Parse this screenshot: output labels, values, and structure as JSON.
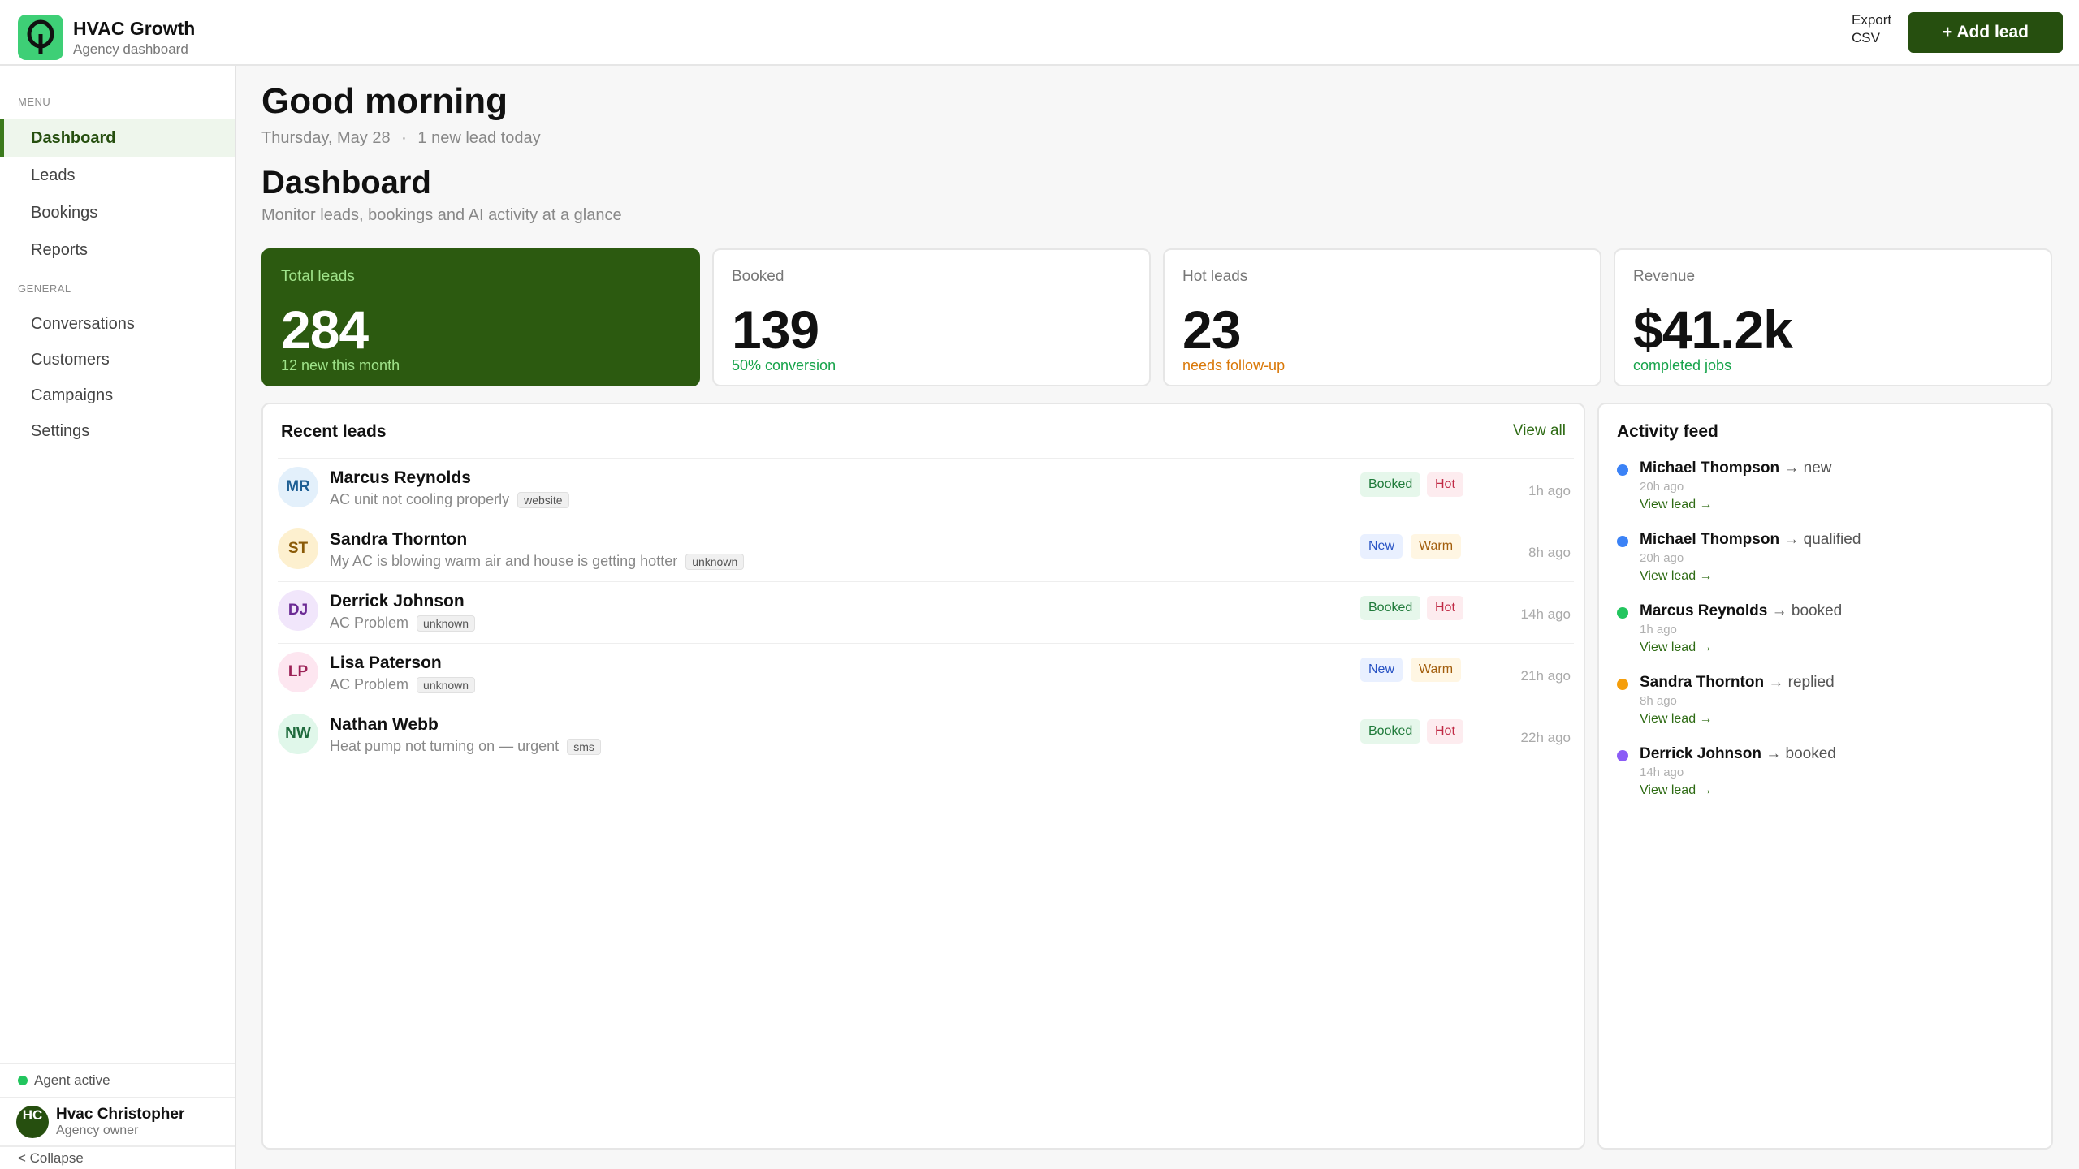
{
  "brand": {
    "name": "HVAC Growth",
    "subtitle": "Agency dashboard"
  },
  "header": {
    "export_label": "Export CSV",
    "add_lead_label": "+ Add lead"
  },
  "sidebar": {
    "menu_heading": "MENU",
    "menu_items": [
      {
        "label": "Dashboard",
        "active": true
      },
      {
        "label": "Leads"
      },
      {
        "label": "Bookings"
      },
      {
        "label": "Reports"
      }
    ],
    "general_heading": "GENERAL",
    "general_items": [
      {
        "label": "Conversations"
      },
      {
        "label": "Customers"
      },
      {
        "label": "Campaigns"
      },
      {
        "label": "Settings"
      }
    ],
    "agent_status": "Agent active",
    "user": {
      "initials": "HC",
      "name": "Hvac Christopher",
      "role": "Agency owner"
    },
    "collapse_label": "< Collapse"
  },
  "greeting": {
    "title": "Good morning",
    "date": "Thursday, May 28",
    "separator": "·",
    "note": "1 new lead today"
  },
  "page": {
    "title": "Dashboard",
    "subtitle": "Monitor leads, bookings and AI activity at a glance"
  },
  "stats": [
    {
      "label": "Total leads",
      "value": "284",
      "note": "12 new this month",
      "note_color": "#9fe38a"
    },
    {
      "label": "Booked",
      "value": "139",
      "note": "50% conversion",
      "note_color": "#16a34a"
    },
    {
      "label": "Hot leads",
      "value": "23",
      "note": "needs follow-up",
      "note_color": "#d97706"
    },
    {
      "label": "Revenue",
      "value": "$41.2k",
      "note": "completed jobs",
      "note_color": "#16a34a"
    }
  ],
  "recent_leads": {
    "title": "Recent leads",
    "view_all": "View all",
    "rows": [
      {
        "initials": "MR",
        "name": "Marcus Reynolds",
        "desc": "AC unit not cooling properly",
        "source": "website",
        "status": "Booked",
        "temp": "Hot",
        "time": "1h ago",
        "avatar_bg": "#e3f0fb",
        "avatar_fg": "#1e5f94"
      },
      {
        "initials": "ST",
        "name": "Sandra Thornton",
        "desc": "My AC is blowing warm air and house is getting hotter",
        "source": "unknown",
        "status": "New",
        "temp": "Warm",
        "time": "8h ago",
        "avatar_bg": "#fdf0cf",
        "avatar_fg": "#8a5a07"
      },
      {
        "initials": "DJ",
        "name": "Derrick Johnson",
        "desc": "AC Problem",
        "source": "unknown",
        "status": "Booked",
        "temp": "Hot",
        "time": "14h ago",
        "avatar_bg": "#f1e6fb",
        "avatar_fg": "#6b2a94"
      },
      {
        "initials": "LP",
        "name": "Lisa Paterson",
        "desc": "AC Problem",
        "source": "unknown",
        "status": "New",
        "temp": "Warm",
        "time": "21h ago",
        "avatar_bg": "#fde6f0",
        "avatar_fg": "#9c2257"
      },
      {
        "initials": "NW",
        "name": "Nathan Webb",
        "desc": "Heat pump not turning on — urgent",
        "source": "sms",
        "status": "Booked",
        "temp": "Hot",
        "time": "22h ago",
        "avatar_bg": "#e0f7ea",
        "avatar_fg": "#1f6b3d"
      }
    ]
  },
  "activity": {
    "title": "Activity feed",
    "items": [
      {
        "name": "Michael Thompson",
        "action": "→ new",
        "time": "20h ago",
        "link": "View lead →",
        "color": "#3b82f6"
      },
      {
        "name": "Michael Thompson",
        "action": "→ qualified",
        "time": "20h ago",
        "link": "View lead →",
        "color": "#3b82f6"
      },
      {
        "name": "Marcus Reynolds",
        "action": "→ booked",
        "time": "1h ago",
        "link": "View lead →",
        "color": "#22c55e"
      },
      {
        "name": "Sandra Thornton",
        "action": "→ replied",
        "time": "8h ago",
        "link": "View lead →",
        "color": "#f59e0b"
      },
      {
        "name": "Derrick Johnson",
        "action": "→ booked",
        "time": "14h ago",
        "link": "View lead →",
        "color": "#8b5cf6"
      }
    ]
  }
}
